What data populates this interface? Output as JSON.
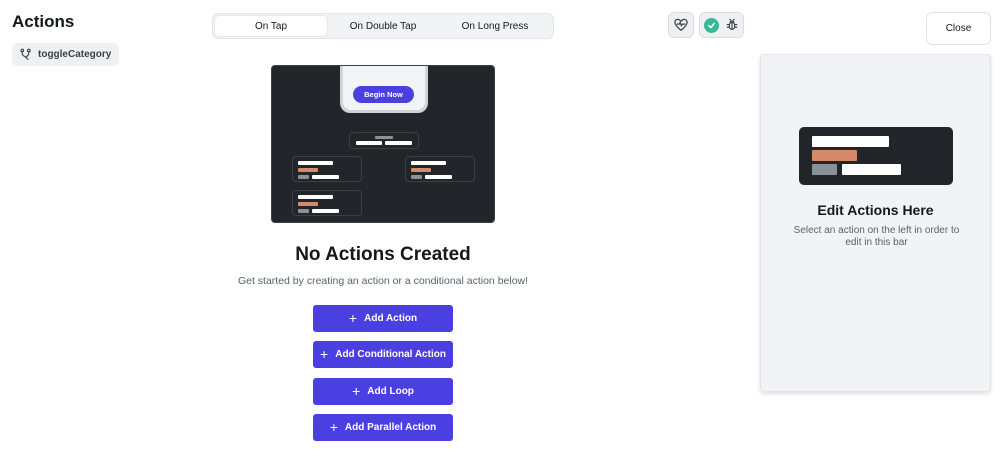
{
  "page": {
    "title": "Actions",
    "chip_label": "toggleCategory",
    "chip_icon": "branch-icon"
  },
  "tabs": [
    {
      "label": "On Tap",
      "active": true
    },
    {
      "label": "On Double Tap",
      "active": false
    },
    {
      "label": "On Long Press",
      "active": false
    }
  ],
  "toolbar": {
    "heart_icon": "heart-pulse-icon",
    "status_icon": "check-circle-icon",
    "bug_icon": "bug-icon",
    "close_label": "Close"
  },
  "illustration": {
    "button_label": "Begin Now"
  },
  "empty_state": {
    "title": "No Actions Created",
    "subtitle": "Get started by creating an action or a conditional action below!"
  },
  "actions": [
    {
      "label": "Add Action"
    },
    {
      "label": "Add Conditional Action"
    },
    {
      "label": "Add Loop"
    },
    {
      "label": "Add Parallel Action"
    }
  ],
  "side_panel": {
    "title": "Edit Actions Here",
    "description": "Select an action on the left in order to edit in this bar"
  },
  "colors": {
    "accent": "#4a3fe0",
    "success": "#39b79a",
    "orange": "#d78a6a",
    "dark": "#22262b"
  }
}
